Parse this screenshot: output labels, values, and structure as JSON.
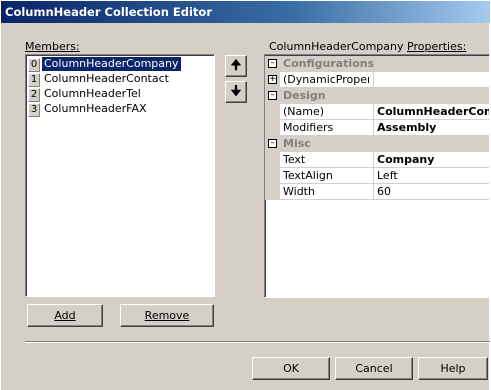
{
  "window": {
    "title": "ColumnHeader Collection Editor"
  },
  "members": {
    "label": "Members:",
    "items": [
      {
        "index": "0",
        "name": "ColumnHeaderCompany"
      },
      {
        "index": "1",
        "name": "ColumnHeaderContact"
      },
      {
        "index": "2",
        "name": "ColumnHeaderTel"
      },
      {
        "index": "3",
        "name": "ColumnHeaderFAX"
      }
    ],
    "move_up_icon": "up-arrow-icon",
    "move_down_icon": "down-arrow-icon",
    "add_label": "Add",
    "remove_label": "Remove"
  },
  "properties": {
    "object_name": "ColumnHeaderCompany",
    "label": "Properties:",
    "categories": {
      "configurations": "Configurations",
      "design": "Design",
      "misc": "Misc"
    },
    "rows": {
      "dynamic": {
        "name": "(DynamicPropertie",
        "value": ""
      },
      "name": {
        "name": "(Name)",
        "value": "ColumnHeaderCompa"
      },
      "modifiers": {
        "name": "Modifiers",
        "value": "Assembly"
      },
      "text": {
        "name": "Text",
        "value": "Company"
      },
      "textalign": {
        "name": "TextAlign",
        "value": "Left"
      },
      "width": {
        "name": "Width",
        "value": "60"
      }
    }
  },
  "buttons": {
    "ok": "OK",
    "cancel": "Cancel",
    "help": "Help"
  },
  "colors": {
    "title_start": "#0a246a",
    "title_end": "#a6caf0",
    "face": "#d4d0c8",
    "selection": "#0a246a"
  }
}
